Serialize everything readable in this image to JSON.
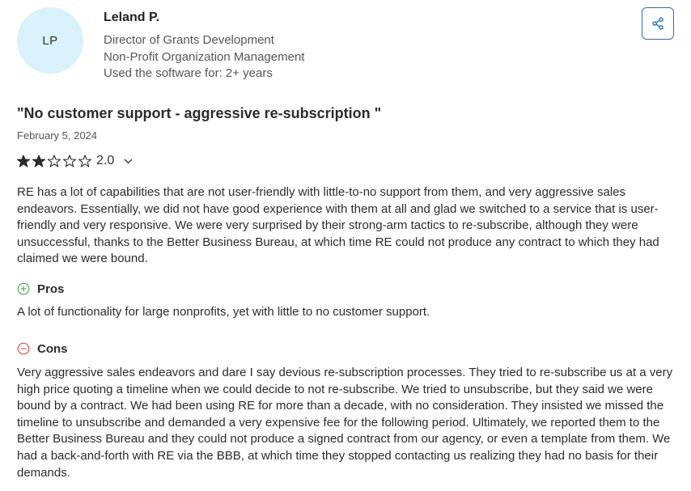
{
  "reviewer": {
    "initials": "LP",
    "name": "Leland P.",
    "role": "Director of Grants Development",
    "industry": "Non-Profit Organization Management",
    "usage": "Used the software for: 2+ years"
  },
  "actions": {
    "share_icon": "share-icon"
  },
  "review": {
    "title": "\"No customer support - aggressive re-subscription \"",
    "date": "February 5, 2024",
    "rating": "2.0",
    "rating_stars": 2,
    "rating_max": 5,
    "body": "RE has a lot of capabilities that are not user-friendly with little-to-no support from them, and very aggressive sales endeavors. Essentially, we did not have good experience with them at all and glad we switched to a service that is user-friendly and very responsive. We were very surprised by their strong-arm tactics to re-subscribe, although they were unsuccessful, thanks to the Better Business Bureau, at which time RE could not produce any contract to which they had claimed we were bound.",
    "pros_label": "Pros",
    "pros": "A lot of functionality for large nonprofits, yet with little to no customer support.",
    "cons_label": "Cons",
    "cons": "Very aggressive sales endeavors and dare I say devious re-subscription processes. They tried to re-subscribe us at a very high price quoting a timeline when we could decide to not re-subscribe. We tried to unsubscribe, but they said we were bound by a contract. We had been using RE for more than a decade, with no consideration. They insisted we missed the timeline to unsubscribe and demanded a very expensive fee for the following period. Ultimately, we reported them to the Better Business Bureau and they could not produce a signed contract from our agency, or even a template from them. We had a back-and-forth with RE via the BBB, at which time they stopped contacting us realizing they had no basis for their demands."
  },
  "colors": {
    "avatar_bg": "#d9f1fb",
    "share_border": "#2c6bb4",
    "pros_icon": "#4caf50",
    "cons_icon": "#e0554d"
  }
}
